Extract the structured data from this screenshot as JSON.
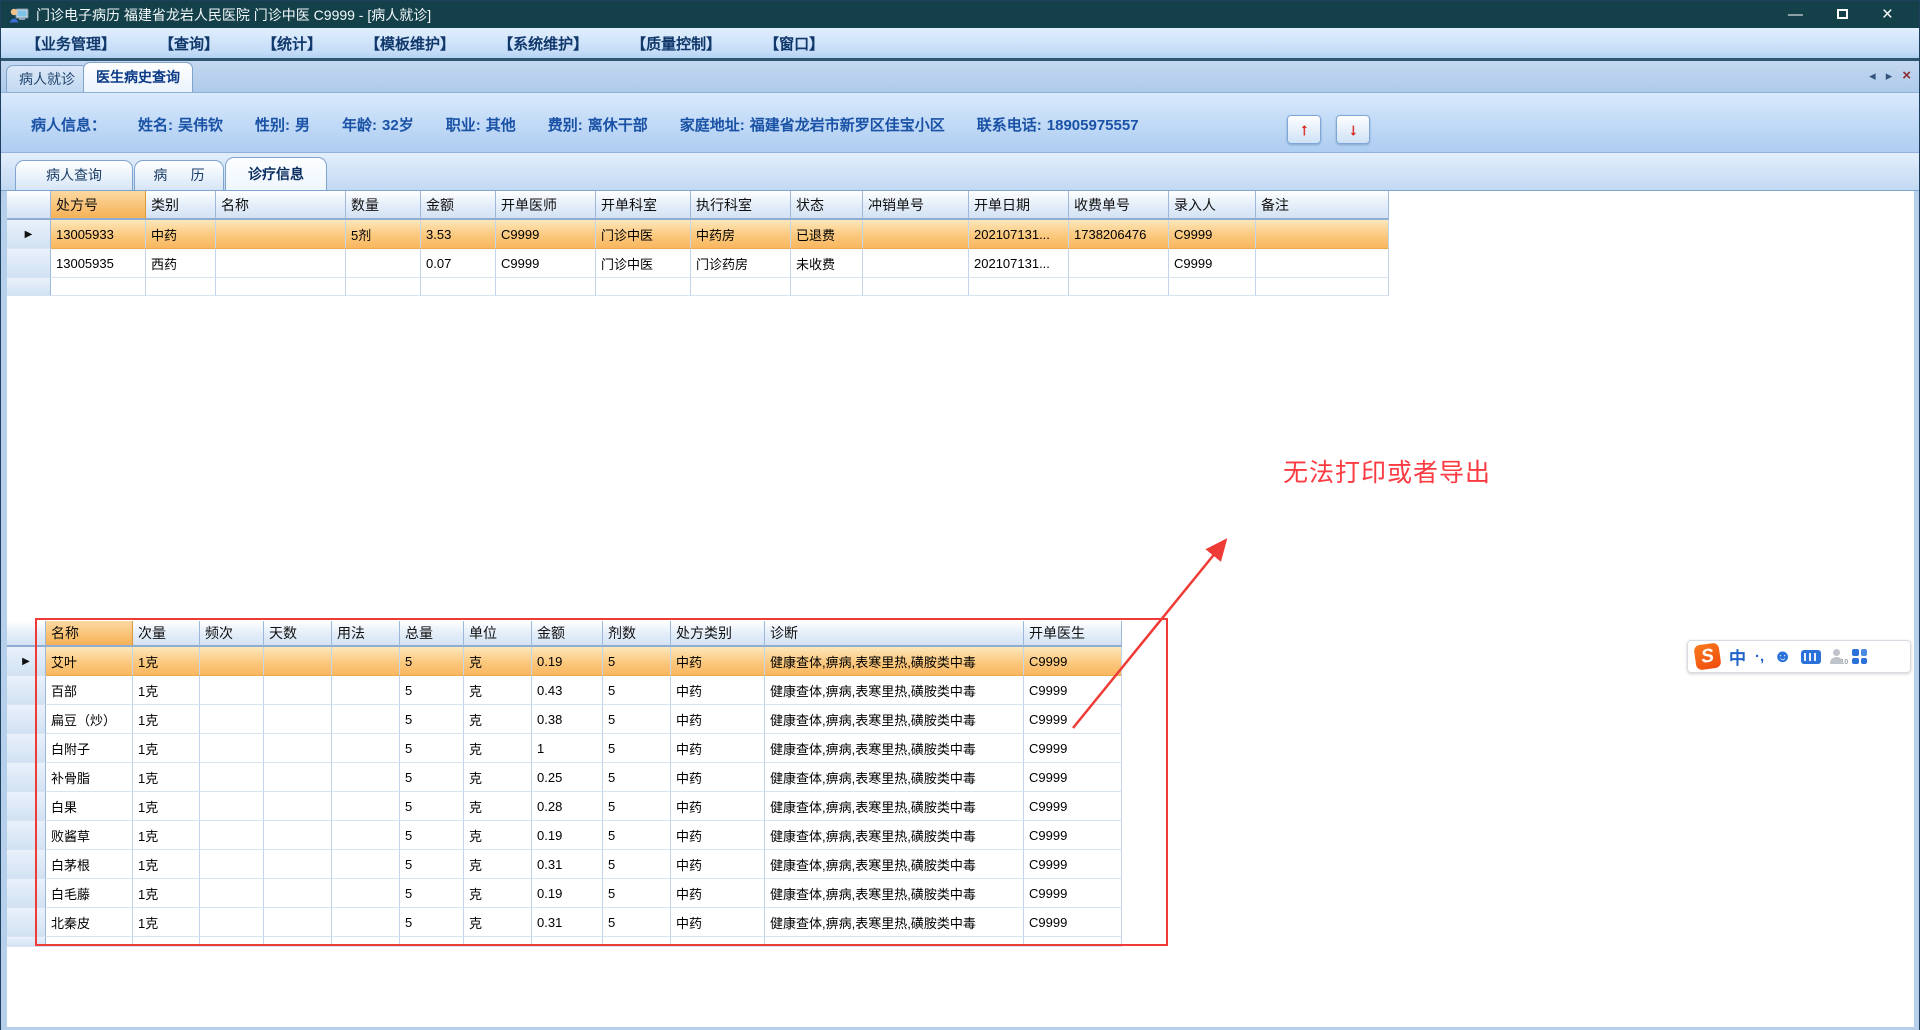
{
  "window": {
    "title": "门诊电子病历  福建省龙岩人民医院  门诊中医  C9999 - [病人就诊]",
    "minimize": "—",
    "close": "×"
  },
  "menu": {
    "items": [
      "【业务管理】",
      "【查询】",
      "【统计】",
      "【模板维护】",
      "【系统维护】",
      "【质量控制】",
      "【窗口】"
    ]
  },
  "main_tabs": {
    "tabs": [
      {
        "label": "病人就诊"
      },
      {
        "label": "医生病史查询"
      }
    ],
    "nav_left": "◂",
    "nav_right": "▸",
    "nav_close": "×"
  },
  "patient": {
    "intro": "病人信息：",
    "fields": [
      {
        "label": "姓名:",
        "value": "吴伟钦"
      },
      {
        "label": "性别:",
        "value": "男"
      },
      {
        "label": "年龄:",
        "value": "32岁"
      },
      {
        "label": "职业:",
        "value": "其他"
      },
      {
        "label": "费别:",
        "value": "离休干部"
      },
      {
        "label": "家庭地址:",
        "value": "福建省龙岩市新罗区佳宝小区"
      },
      {
        "label": "联系电话:",
        "value": "18905975557"
      }
    ],
    "up_arrow": "↑",
    "down_arrow": "↓"
  },
  "sub_tabs": {
    "tabs": [
      {
        "label": "病人查询"
      },
      {
        "label": "病      历"
      },
      {
        "label": "诊疗信息"
      }
    ]
  },
  "prescription_grid": {
    "columns": [
      "处方号",
      "类别",
      "名称",
      "数量",
      "金额",
      "开单医师",
      "开单科室",
      "执行科室",
      "状态",
      "冲销单号",
      "开单日期",
      "收费单号",
      "录入人",
      "备注"
    ],
    "rows": [
      {
        "selected": true,
        "cells": [
          "13005933",
          "中药",
          "",
          "5剂",
          "3.53",
          "C9999",
          "门诊中医",
          "中药房",
          "已退费",
          "",
          "202107131...",
          "1738206476",
          "C9999",
          ""
        ]
      },
      {
        "selected": false,
        "cells": [
          "13005935",
          "西药",
          "",
          "",
          "0.07",
          "C9999",
          "门诊中医",
          "门诊药房",
          "未收费",
          "",
          "202107131...",
          "",
          "C9999",
          ""
        ]
      }
    ]
  },
  "detail_grid": {
    "columns": [
      "名称",
      "次量",
      "频次",
      "天数",
      "用法",
      "总量",
      "单位",
      "金额",
      "剂数",
      "处方类别",
      "诊断",
      "开单医生"
    ],
    "rows": [
      {
        "selected": true,
        "cells": [
          "艾叶",
          "1克",
          "",
          "",
          "",
          "5",
          "克",
          "0.19",
          "5",
          "中药",
          "健康查体,痹病,表寒里热,磺胺类中毒",
          "C9999"
        ]
      },
      {
        "selected": false,
        "cells": [
          "百部",
          "1克",
          "",
          "",
          "",
          "5",
          "克",
          "0.43",
          "5",
          "中药",
          "健康查体,痹病,表寒里热,磺胺类中毒",
          "C9999"
        ]
      },
      {
        "selected": false,
        "cells": [
          "扁豆（炒）",
          "1克",
          "",
          "",
          "",
          "5",
          "克",
          "0.38",
          "5",
          "中药",
          "健康查体,痹病,表寒里热,磺胺类中毒",
          "C9999"
        ]
      },
      {
        "selected": false,
        "cells": [
          "白附子",
          "1克",
          "",
          "",
          "",
          "5",
          "克",
          "1",
          "5",
          "中药",
          "健康查体,痹病,表寒里热,磺胺类中毒",
          "C9999"
        ]
      },
      {
        "selected": false,
        "cells": [
          "补骨脂",
          "1克",
          "",
          "",
          "",
          "5",
          "克",
          "0.25",
          "5",
          "中药",
          "健康查体,痹病,表寒里热,磺胺类中毒",
          "C9999"
        ]
      },
      {
        "selected": false,
        "cells": [
          "白果",
          "1克",
          "",
          "",
          "",
          "5",
          "克",
          "0.28",
          "5",
          "中药",
          "健康查体,痹病,表寒里热,磺胺类中毒",
          "C9999"
        ]
      },
      {
        "selected": false,
        "cells": [
          "败酱草",
          "1克",
          "",
          "",
          "",
          "5",
          "克",
          "0.19",
          "5",
          "中药",
          "健康查体,痹病,表寒里热,磺胺类中毒",
          "C9999"
        ]
      },
      {
        "selected": false,
        "cells": [
          "白茅根",
          "1克",
          "",
          "",
          "",
          "5",
          "克",
          "0.31",
          "5",
          "中药",
          "健康查体,痹病,表寒里热,磺胺类中毒",
          "C9999"
        ]
      },
      {
        "selected": false,
        "cells": [
          "白毛藤",
          "1克",
          "",
          "",
          "",
          "5",
          "克",
          "0.19",
          "5",
          "中药",
          "健康查体,痹病,表寒里热,磺胺类中毒",
          "C9999"
        ]
      },
      {
        "selected": false,
        "cells": [
          "北秦皮",
          "1克",
          "",
          "",
          "",
          "5",
          "克",
          "0.31",
          "5",
          "中药",
          "健康查体,痹病,表寒里热,磺胺类中毒",
          "C9999"
        ]
      }
    ]
  },
  "annotation": {
    "text": "无法打印或者导出"
  },
  "ime": {
    "logo": "S",
    "lang": "中",
    "punct": "·,",
    "smiley": "☻",
    "badge": "10"
  },
  "colors": {
    "annotation_red": "#ef3b36",
    "selected_row_orange": "#fbc97e",
    "sorted_header_orange": "#f6b155",
    "titlebar": "#14404a",
    "menu_text": "#10386b"
  }
}
